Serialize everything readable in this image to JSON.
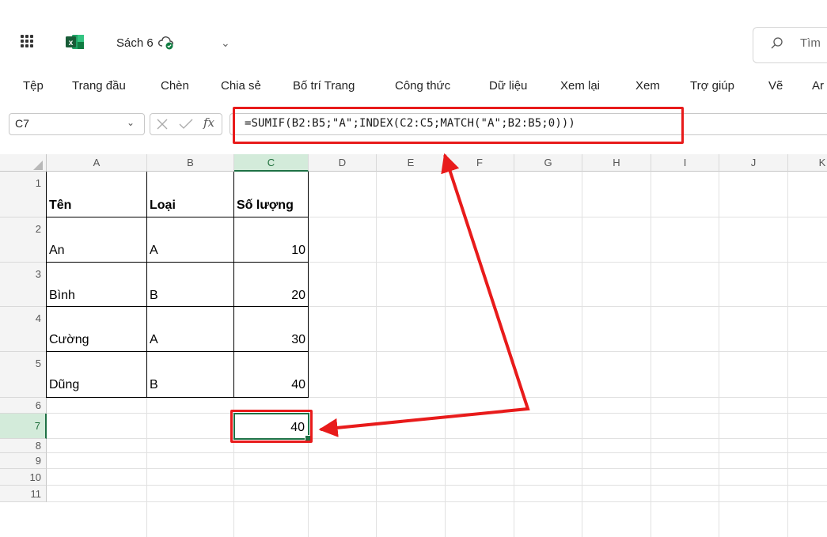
{
  "titlebar": {
    "doc_title": "Sách 6",
    "search_placeholder": "Tìm"
  },
  "ribbon": {
    "tabs": [
      "Tệp",
      "Trang đầu",
      "Chèn",
      "Chia sẻ",
      "Bố trí Trang",
      "Công thức",
      "Dữ liệu",
      "Xem lại",
      "Xem",
      "Trợ giúp",
      "Vẽ",
      "Ar"
    ]
  },
  "formula_bar": {
    "name_box": "C7",
    "fx_label": "fx",
    "formula": "=SUMIF(B2:B5;\"A\";INDEX(C2:C5;MATCH(\"A\";B2:B5;0)))"
  },
  "sheet": {
    "columns": [
      "A",
      "B",
      "C",
      "D",
      "E",
      "F",
      "G",
      "H",
      "I",
      "J",
      "K"
    ],
    "rows": [
      "1",
      "2",
      "3",
      "4",
      "5",
      "6",
      "7",
      "8",
      "9",
      "10",
      "11"
    ],
    "selected_cell": "C7",
    "headers": [
      "Tên",
      "Loại",
      "Số lượng"
    ],
    "data": [
      [
        "An",
        "A",
        "10"
      ],
      [
        "Bình",
        "B",
        "20"
      ],
      [
        "Cường",
        "A",
        "30"
      ],
      [
        "Dũng",
        "B",
        "40"
      ]
    ],
    "result_value": "40"
  },
  "colors": {
    "accent_green": "#1e7145",
    "annotation_red": "#e81b1b"
  },
  "icons": {
    "app_launcher": "waffle-icon",
    "app_logo": "excel-logo-icon",
    "cloud_saved": "cloud-check-icon",
    "search": "search-icon",
    "cancel": "cancel-icon",
    "enter": "check-icon"
  }
}
